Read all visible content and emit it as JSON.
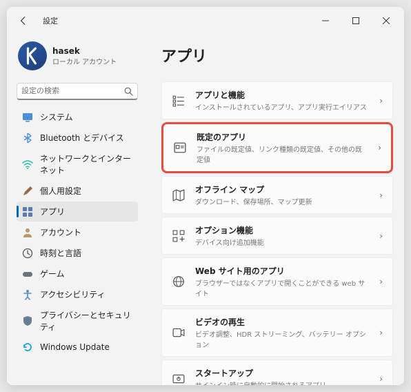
{
  "app_title": "設定",
  "profile": {
    "name": "hasek",
    "type": "ローカル アカウント"
  },
  "search_placeholder": "設定の検索",
  "sidebar": {
    "items": [
      {
        "label": "システム"
      },
      {
        "label": "Bluetooth とデバイス"
      },
      {
        "label": "ネットワークとインターネット"
      },
      {
        "label": "個人用設定"
      },
      {
        "label": "アプリ"
      },
      {
        "label": "アカウント"
      },
      {
        "label": "時刻と言語"
      },
      {
        "label": "ゲーム"
      },
      {
        "label": "アクセシビリティ"
      },
      {
        "label": "プライバシーとセキュリティ"
      },
      {
        "label": "Windows Update"
      }
    ]
  },
  "main": {
    "heading": "アプリ",
    "cards": [
      {
        "title": "アプリと機能",
        "desc": "インストールされているアプリ、アプリ実行エイリアス"
      },
      {
        "title": "既定のアプリ",
        "desc": "ファイルの既定値、リンク種類の既定値、その他の既定値"
      },
      {
        "title": "オフライン マップ",
        "desc": "ダウンロード、保存場所、マップ更新"
      },
      {
        "title": "オプション機能",
        "desc": "デバイス向け追加機能"
      },
      {
        "title": "Web サイト用のアプリ",
        "desc": "ブラウザーではなくアプリで開くことができる web サイト"
      },
      {
        "title": "ビデオの再生",
        "desc": "ビデオ調整、HDR ストリーミング、バッテリー オプション"
      },
      {
        "title": "スタートアップ",
        "desc": "サインイン時に自動的に開始されるアプリ"
      }
    ]
  }
}
